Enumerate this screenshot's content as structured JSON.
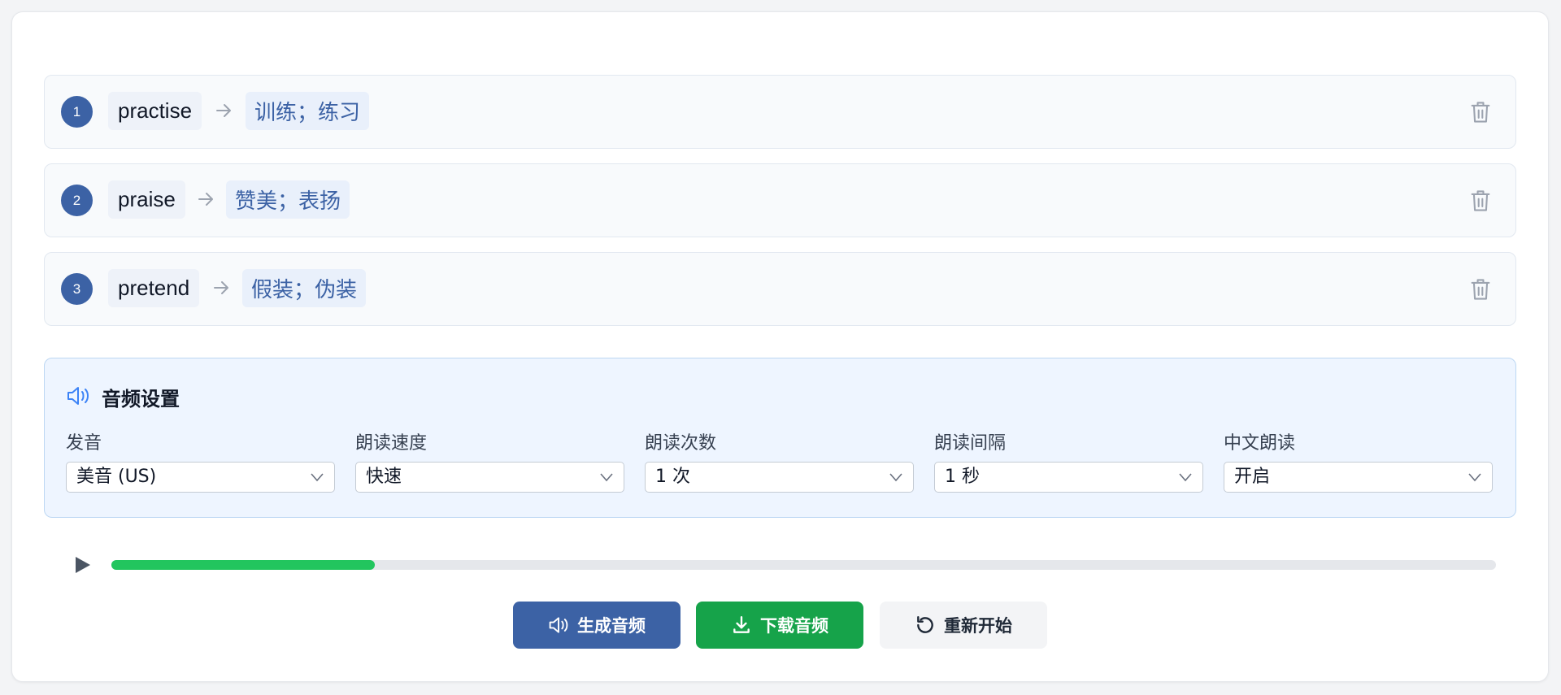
{
  "words": [
    {
      "index": "1",
      "english": "practise",
      "chinese": "训练；练习"
    },
    {
      "index": "2",
      "english": "praise",
      "chinese": "赞美；表扬"
    },
    {
      "index": "3",
      "english": "pretend",
      "chinese": "假装；伪装"
    }
  ],
  "settings": {
    "title": "音频设置",
    "fields": [
      {
        "label": "发音",
        "value": "美音 (US)"
      },
      {
        "label": "朗读速度",
        "value": "快速"
      },
      {
        "label": "朗读次数",
        "value": "1 次"
      },
      {
        "label": "朗读间隔",
        "value": "1 秒"
      },
      {
        "label": "中文朗读",
        "value": "开启"
      }
    ]
  },
  "player": {
    "progress_percent": 19
  },
  "actions": {
    "generate": "生成音频",
    "download": "下载音频",
    "reset": "重新开始"
  },
  "colors": {
    "primary": "#3c62a5",
    "success": "#16a34a",
    "progress": "#22c55e"
  }
}
